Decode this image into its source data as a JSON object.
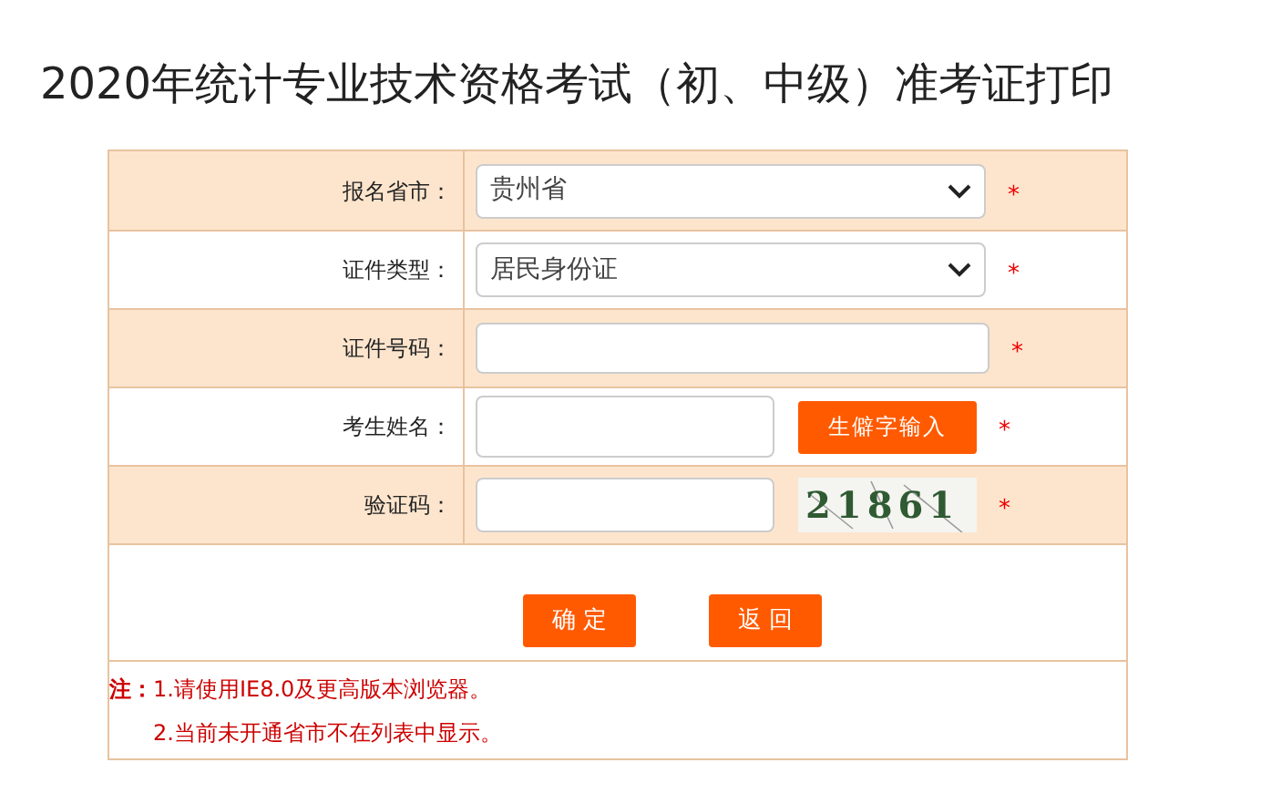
{
  "title": "2020年统计专业技术资格考试（初、中级）准考证打印",
  "rows": [
    {
      "kind": "select",
      "label": "报名省市：",
      "value": "贵州省",
      "required": "*"
    },
    {
      "kind": "select",
      "label": "证件类型：",
      "value": "居民身份证",
      "required": "*"
    },
    {
      "kind": "input",
      "label": "证件号码：",
      "required": "*"
    },
    {
      "kind": "input_button",
      "label": "考生姓名：",
      "button": "生僻字输入",
      "required": "*"
    },
    {
      "kind": "captcha",
      "label": "验证码：",
      "code": "21861",
      "required": "*"
    }
  ],
  "buttons": [
    "确 定",
    "返 回"
  ],
  "notes": {
    "label": "注：",
    "items": [
      "1.请使用IE8.0及更高版本浏览器。",
      "2.当前未开通省市不在列表中显示。"
    ]
  }
}
